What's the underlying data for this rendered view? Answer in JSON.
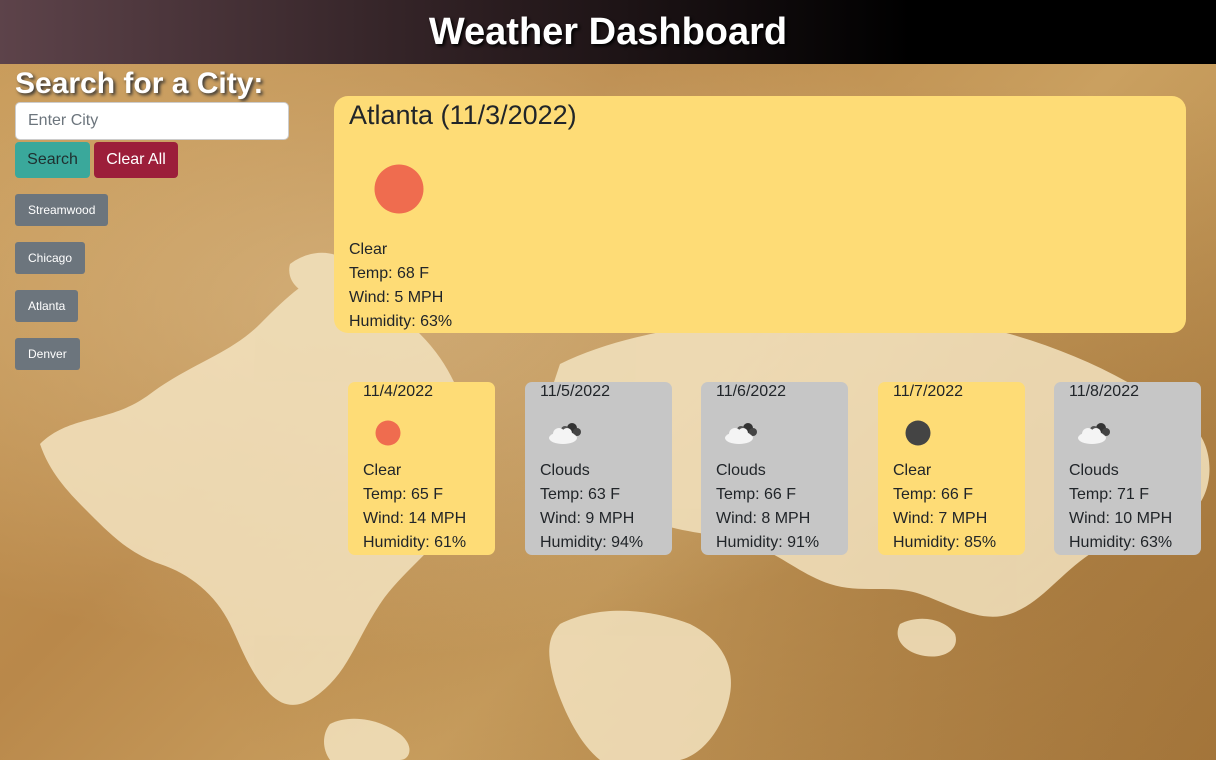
{
  "header": {
    "title": "Weather Dashboard"
  },
  "search": {
    "heading": "Search for a City:",
    "placeholder": "Enter City",
    "value": "",
    "search_label": "Search",
    "clear_label": "Clear All"
  },
  "history": [
    {
      "label": "Streamwood"
    },
    {
      "label": "Chicago"
    },
    {
      "label": "Atlanta"
    },
    {
      "label": "Denver"
    }
  ],
  "current": {
    "title": "Atlanta (11/3/2022)",
    "icon": "sun-icon",
    "condition": "Clear",
    "temp": "Temp: 68 F",
    "wind": "Wind: 5 MPH",
    "humidity": "Humidity: 63%"
  },
  "forecast": [
    {
      "date": "11/4/2022",
      "icon": "sun-icon",
      "condition": "Clear",
      "temp": "Temp: 65 F",
      "wind": "Wind: 14 MPH",
      "humidity": "Humidity: 61%"
    },
    {
      "date": "11/5/2022",
      "icon": "clouds-icon",
      "condition": "Clouds",
      "temp": "Temp: 63 F",
      "wind": "Wind: 9 MPH",
      "humidity": "Humidity: 94%"
    },
    {
      "date": "11/6/2022",
      "icon": "clouds-icon",
      "condition": "Clouds",
      "temp": "Temp: 66 F",
      "wind": "Wind: 8 MPH",
      "humidity": "Humidity: 91%"
    },
    {
      "date": "11/7/2022",
      "icon": "moon-icon",
      "condition": "Clear",
      "temp": "Temp: 66 F",
      "wind": "Wind: 7 MPH",
      "humidity": "Humidity: 85%"
    },
    {
      "date": "11/8/2022",
      "icon": "clouds-icon",
      "condition": "Clouds",
      "temp": "Temp: 71 F",
      "wind": "Wind: 10 MPH",
      "humidity": "Humidity: 63%"
    }
  ],
  "colors": {
    "sunny_card": "#fedc76",
    "cloudy_card": "#c6c6c6",
    "search_button": "#3aa89b",
    "clear_button": "#9c1e3a",
    "history_button": "#6c757d",
    "sun": "#ef6c4f",
    "moon": "#444444"
  }
}
